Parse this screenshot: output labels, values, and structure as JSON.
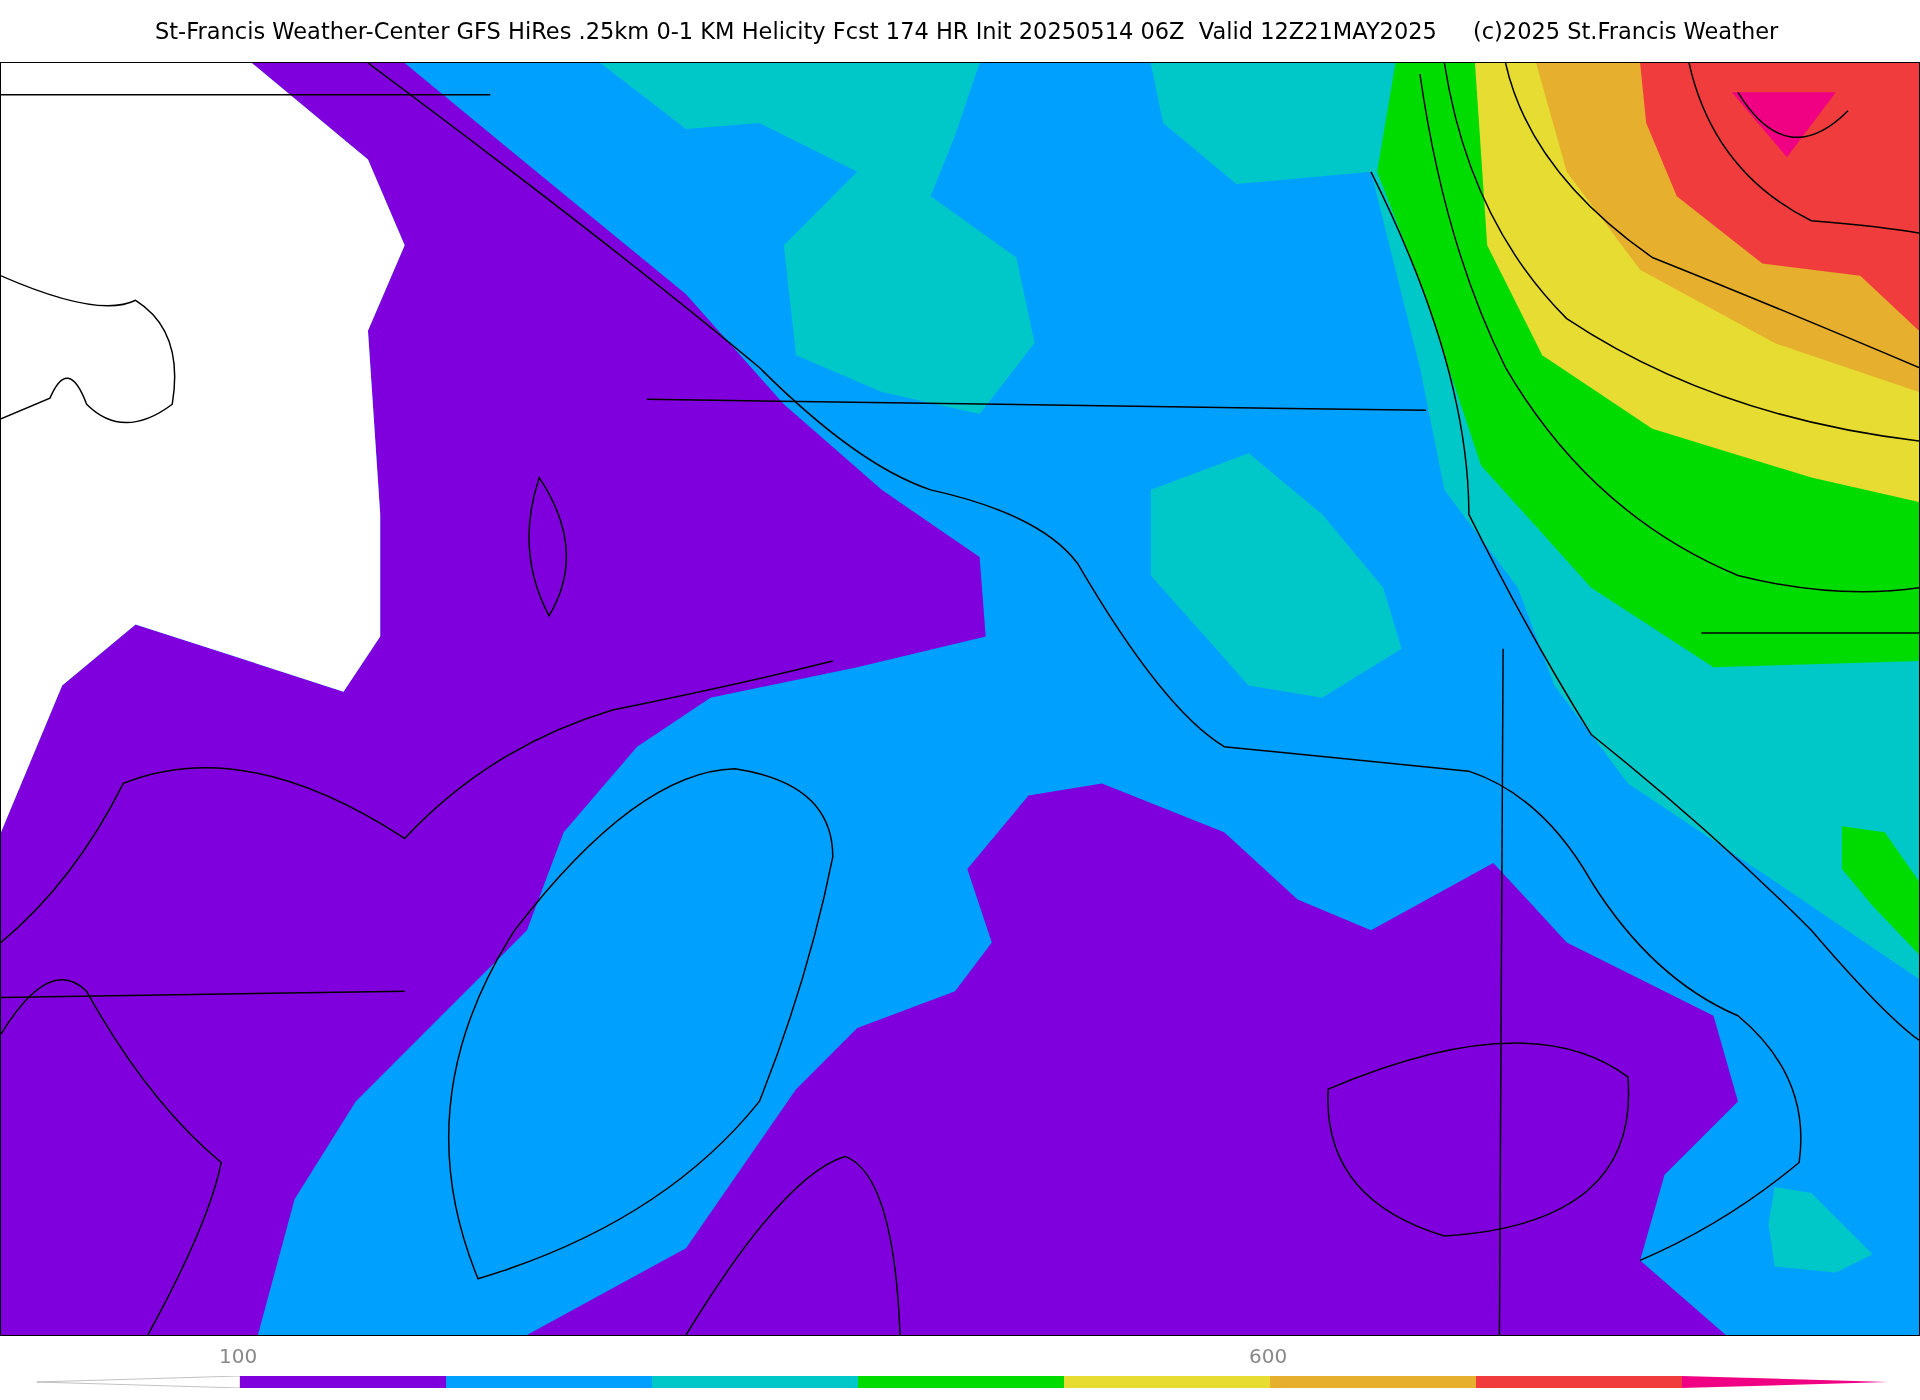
{
  "header": {
    "title": "St-Francis Weather-Center GFS HiRes .25km 0-1 KM Helicity Fcst 174 HR Init 20250514 06Z  Valid 12Z21MAY2025",
    "copyright": "(c)2025 St.Francis Weather"
  },
  "colorbar": [
    {
      "kind": "low_end",
      "color": "#ffffff"
    },
    {
      "kind": "segment",
      "color": "#7f00dc",
      "label": "100"
    },
    {
      "kind": "segment",
      "color": "#00a0ff"
    },
    {
      "kind": "segment",
      "color": "#00c8c8"
    },
    {
      "kind": "segment",
      "color": "#00dc00"
    },
    {
      "kind": "segment",
      "color": "#e6dc32"
    },
    {
      "kind": "segment",
      "color": "#e6af2d",
      "label": "600"
    },
    {
      "kind": "segment",
      "color": "#f03c3c"
    },
    {
      "kind": "high_end",
      "color": "#f00082"
    }
  ]
}
